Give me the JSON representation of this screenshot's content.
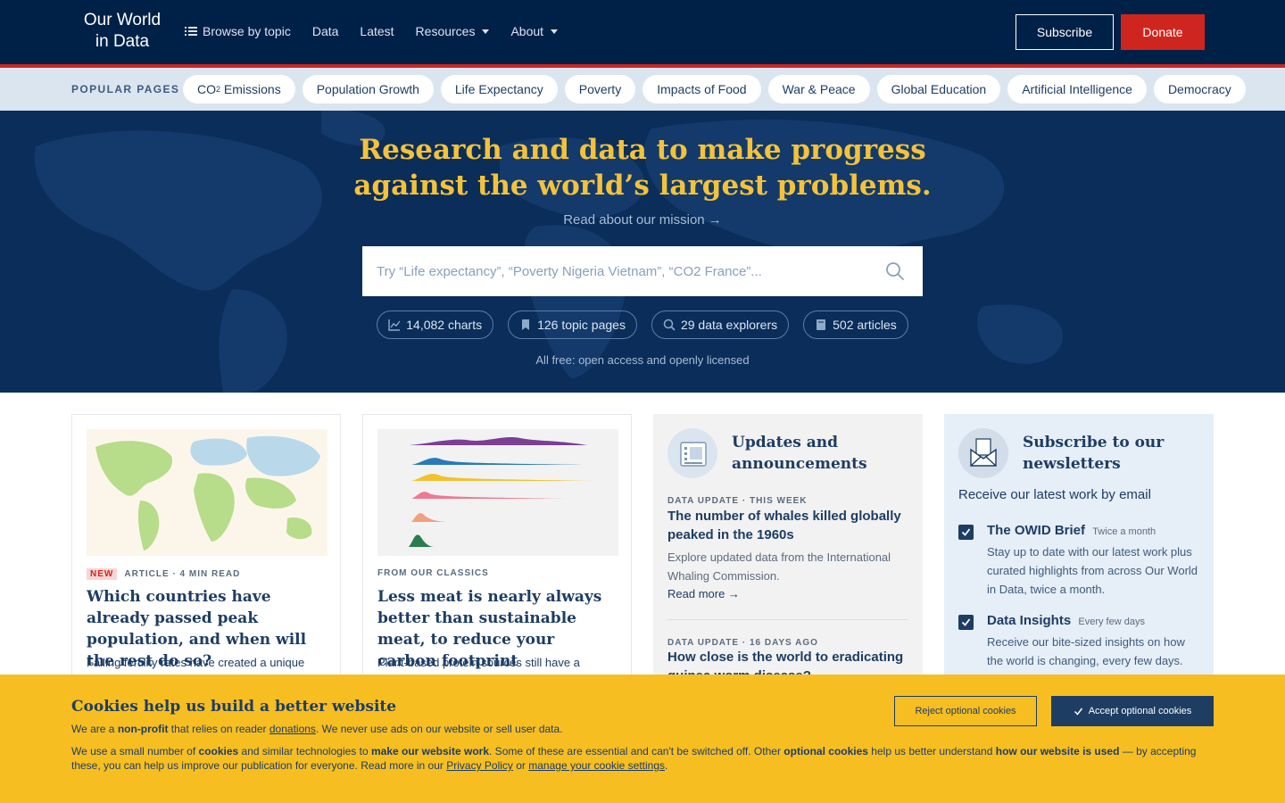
{
  "header": {
    "logo_line1": "Our World",
    "logo_line2": "in Data",
    "nav": {
      "browse": "Browse by topic",
      "data": "Data",
      "latest": "Latest",
      "resources": "Resources",
      "about": "About"
    },
    "subscribe": "Subscribe",
    "donate": "Donate"
  },
  "popular": {
    "label": "POPULAR PAGES",
    "co2_prefix": "CO",
    "co2_sub": "2",
    "co2_suffix": " Emissions",
    "items": [
      "Population Growth",
      "Life Expectancy",
      "Poverty",
      "Impacts of Food",
      "War & Peace",
      "Global Education",
      "Artificial Intelligence",
      "Democracy"
    ]
  },
  "hero": {
    "title_line1": "Research and data to make progress",
    "title_line2": "against the world’s largest problems.",
    "mission": "Read about our mission →",
    "search_placeholder": "Try “Life expectancy”, “Poverty Nigeria Vietnam”, “CO2 France”...",
    "stats": [
      "14,082 charts",
      "126 topic pages",
      "29 data explorers",
      "502 articles"
    ],
    "free": "All free: open access and openly licensed"
  },
  "cards": [
    {
      "badge": "NEW",
      "meta": "ARTICLE · 4 MIN READ",
      "title": "Which countries have already passed peak population, and when will the rest do so?",
      "desc": "Falling fertility rates have created a unique"
    },
    {
      "meta": "FROM OUR CLASSICS",
      "title": "Less meat is nearly always better than sustainable meat, to reduce your carbon footprint",
      "desc": "Plant-based protein sources still have a"
    }
  ],
  "updates": {
    "title": "Updates and announcements",
    "items": [
      {
        "meta": "DATA UPDATE · THIS WEEK",
        "title": "The number of whales killed globally peaked in the 1960s",
        "desc": "Explore updated data from the International Whaling Commission.",
        "link": "Read more →"
      },
      {
        "meta": "DATA UPDATE · 16 DAYS AGO",
        "title": "How close is the world to eradicating guinea worm disease?"
      }
    ]
  },
  "newsletter": {
    "title": "Subscribe to our newsletters",
    "subtitle": "Receive our latest work by email",
    "items": [
      {
        "name": "The OWID Brief",
        "freq": "Twice a month",
        "desc": "Stay up to date with our latest work plus curated highlights from across Our World in Data, twice a month.",
        "checked": true
      },
      {
        "name": "Data Insights",
        "freq": "Every few days",
        "desc": "Receive our bite-sized insights on how the world is changing, every few days.",
        "checked": true
      }
    ]
  },
  "cookie": {
    "title": "Cookies help us build a better website",
    "p1_a": "We are a ",
    "p1_b": "non-profit",
    "p1_c": " that relies on reader ",
    "p1_d": "donations",
    "p1_e": ". We never use ads on our website or sell user data.",
    "p2_a": "We use a small number of ",
    "p2_b": "cookies",
    "p2_c": " and similar technologies to ",
    "p2_d": "make our website work",
    "p2_e": ". Some of these are essential and can't be switched off. Other ",
    "p2_f": "optional cookies",
    "p2_g": " help us better understand ",
    "p2_h": "how our website is used",
    "p2_i": " — by accepting these, you can help us improve our publication for everyone. Read more in our ",
    "p2_j": "Privacy Policy",
    "p2_k": " or ",
    "p2_l": "manage your cookie settings",
    "p2_m": ".",
    "reject": "Reject optional cookies",
    "accept": "Accept optional cookies"
  },
  "colors": {
    "navy": "#002147",
    "red": "#ce261e",
    "gold": "#f4c23a",
    "banner": "#f7be22"
  }
}
